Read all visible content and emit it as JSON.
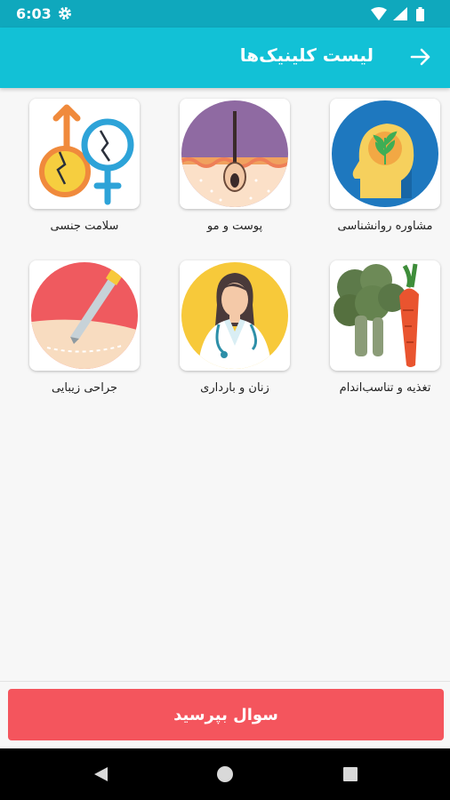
{
  "status_bar": {
    "time": "6:03"
  },
  "app_bar": {
    "title": "لیست کلینیک‌ها",
    "back_icon": "arrow-right-icon"
  },
  "clinics": [
    {
      "label": "مشاوره روانشناسی",
      "icon": "head-plant-icon"
    },
    {
      "label": "پوست و مو",
      "icon": "skin-hair-icon"
    },
    {
      "label": "سلامت جنسی",
      "icon": "gender-symbols-icon"
    },
    {
      "label": "تغذیه و تناسب‌اندام",
      "icon": "vegetables-icon"
    },
    {
      "label": "زنان و بارداری",
      "icon": "female-doctor-icon"
    },
    {
      "label": "جراحی زیبایی",
      "icon": "scalpel-icon"
    }
  ],
  "ask_button": {
    "label": "سوال بپرسید",
    "color": "#f4555d"
  },
  "colors": {
    "status_bar": "#0fa8bd",
    "app_bar": "#12c1d6",
    "background": "#f7f7f7"
  }
}
